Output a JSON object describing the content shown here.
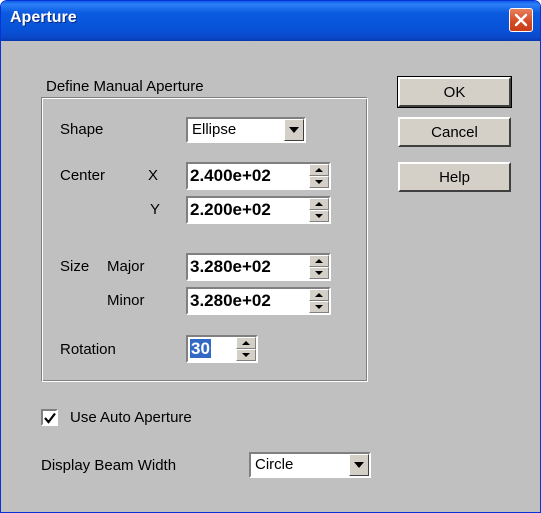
{
  "window": {
    "title": "Aperture"
  },
  "manual": {
    "group_label": "Define Manual Aperture",
    "shape": {
      "label": "Shape",
      "value": "Ellipse"
    },
    "center": {
      "label": "Center",
      "x_label": "X",
      "x_value": "2.400e+02",
      "y_label": "Y",
      "y_value": "2.200e+02"
    },
    "size": {
      "label": "Size",
      "major_label": "Major",
      "major_value": "3.280e+02",
      "minor_label": "Minor",
      "minor_value": "3.280e+02"
    },
    "rotation": {
      "label": "Rotation",
      "value": "30"
    }
  },
  "buttons": {
    "ok": "OK",
    "cancel": "Cancel",
    "help": "Help"
  },
  "auto_aperture": {
    "label": "Use Auto Aperture",
    "checked": true
  },
  "beam_width": {
    "label": "Display Beam Width",
    "value": "Circle"
  },
  "colors": {
    "title_bar": "#0753d8",
    "dialog_bg": "#c0c0c0",
    "selection": "#316ac5",
    "close_button": "#d34a22"
  },
  "icons": {
    "close": "close-icon",
    "dropdown": "chevron-down-icon",
    "spin_up": "spin-up-icon",
    "spin_down": "spin-down-icon",
    "check": "checkmark-icon"
  }
}
